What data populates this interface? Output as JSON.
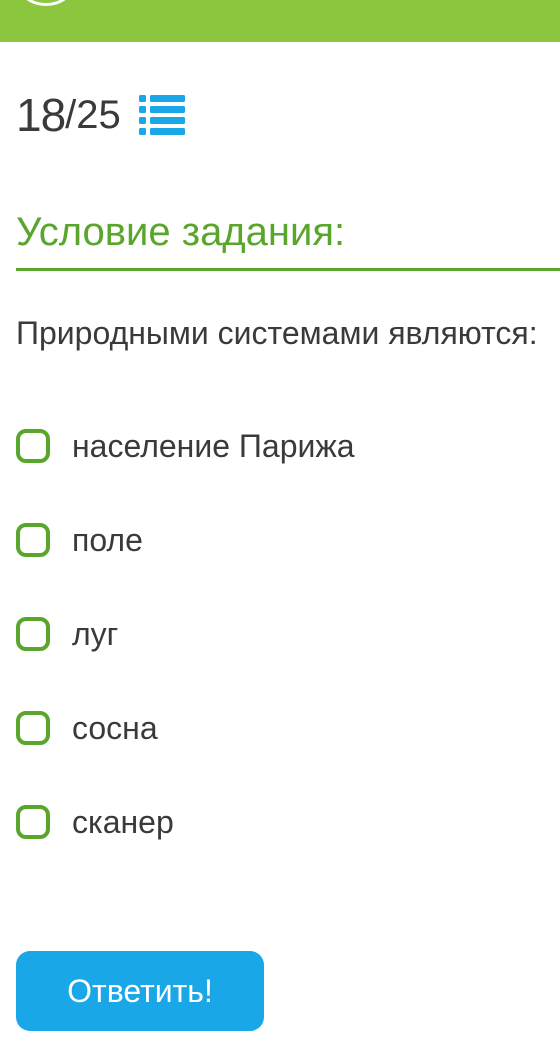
{
  "header": {
    "bar_color": "#8cc63f",
    "icon": "menu-circle-icon"
  },
  "progress": {
    "current": "18",
    "separator": "/",
    "total": "25",
    "list_icon": "list-icon",
    "list_icon_color": "#1aa7e8"
  },
  "task": {
    "section_title": "Условие задания:",
    "accent_color": "#5aa52c",
    "question": "Природными системами являются:"
  },
  "options": [
    {
      "label": "население Парижа",
      "checked": false
    },
    {
      "label": "поле",
      "checked": false
    },
    {
      "label": "луг",
      "checked": false
    },
    {
      "label": "сосна",
      "checked": false
    },
    {
      "label": "сканер",
      "checked": false
    }
  ],
  "submit": {
    "label": "Ответить!",
    "color": "#1aa7e8"
  }
}
